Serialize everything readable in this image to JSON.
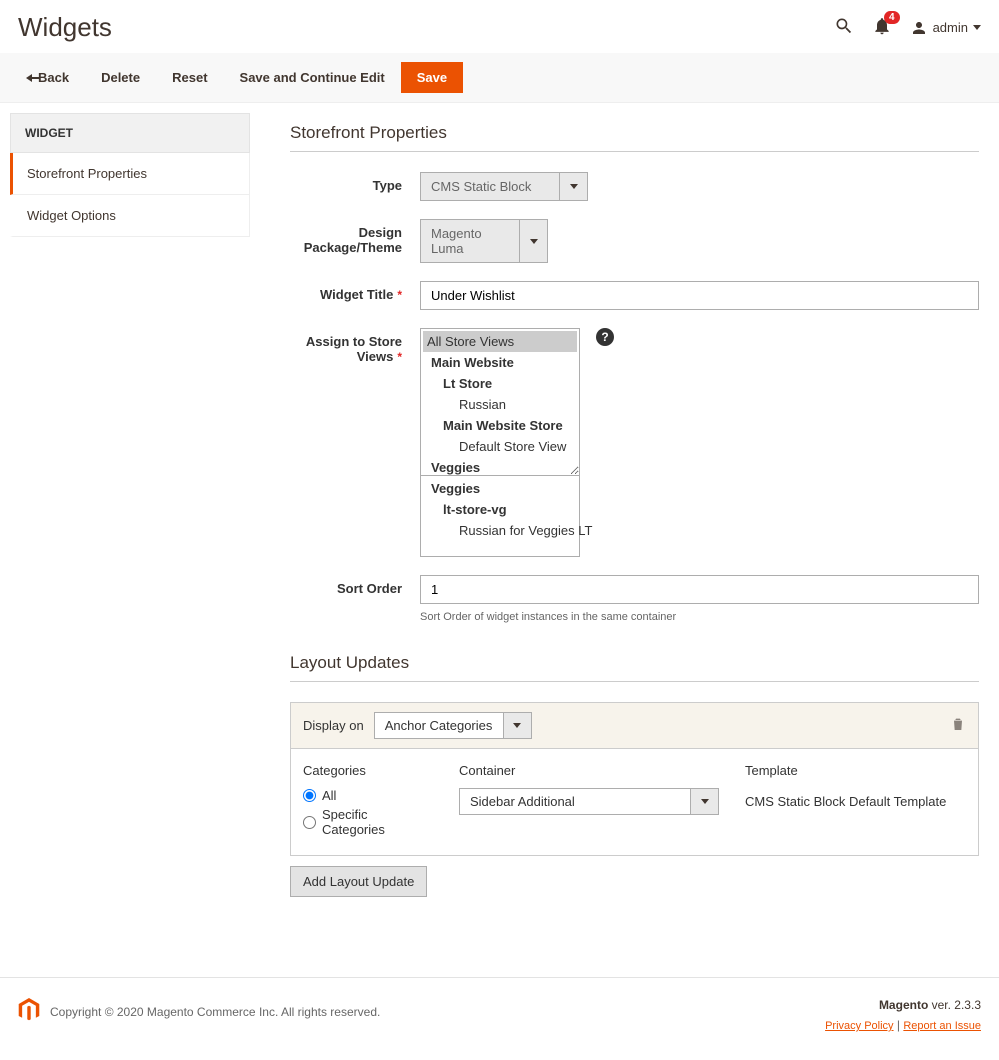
{
  "page": {
    "title": "Widgets",
    "notif_count": "4",
    "user": "admin"
  },
  "actions": {
    "back": "Back",
    "delete": "Delete",
    "reset": "Reset",
    "save_continue": "Save and Continue Edit",
    "save": "Save"
  },
  "sidebar": {
    "header": "WIDGET",
    "item_props": "Storefront Properties",
    "item_opts": "Widget Options"
  },
  "section1": {
    "title": "Storefront Properties",
    "type_label": "Type",
    "type_value": "CMS Static Block",
    "theme_label": "Design Package/Theme",
    "theme_value": "Magento Luma",
    "widget_title_label": "Widget Title",
    "widget_title_value": "Under Wishlist",
    "assign_label": "Assign to Store Views",
    "stores": {
      "all": "All Store Views",
      "g1": "Main Website",
      "g1s1": "Lt Store",
      "g1s1v1": "Russian",
      "g1s2": "Main Website Store",
      "g1s2v1": "Default Store View",
      "g2": "Veggies",
      "g3": "Veggies",
      "g3s1": "lt-store-vg",
      "g3s1v1": "Russian for Veggies LT"
    },
    "sort_label": "Sort Order",
    "sort_value": "1",
    "sort_help": "Sort Order of widget instances in the same container"
  },
  "section2": {
    "title": "Layout Updates",
    "display_on_label": "Display on",
    "display_on_value": "Anchor Categories",
    "cat_label": "Categories",
    "cat_all": "All",
    "cat_specific": "Specific Categories",
    "container_label": "Container",
    "container_value": "Sidebar Additional",
    "tmpl_label": "Template",
    "tmpl_value": "CMS Static Block Default Template",
    "add_btn": "Add Layout Update"
  },
  "footer": {
    "copyright": "Copyright © 2020 Magento Commerce Inc. All rights reserved.",
    "brand": "Magento",
    "ver": "ver. 2.3.3",
    "privacy": "Privacy Policy",
    "sep": " | ",
    "report": "Report an Issue"
  }
}
